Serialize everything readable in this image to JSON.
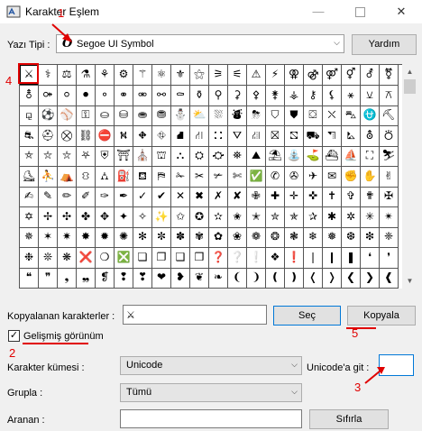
{
  "window": {
    "title": "Karakter Eşlem",
    "minimize_glyph": "—",
    "close_glyph": "✕"
  },
  "font_row": {
    "label": "Yazı Tipi :",
    "font_icon": "O",
    "selected_font": "Segoe UI Symbol",
    "help_label": "Yardım"
  },
  "chars": [
    [
      "⚔",
      "⚕",
      "⚖",
      "⚗",
      "⚘",
      "⚙",
      "⚚",
      "⚛",
      "⚜",
      "⚝",
      "⚞",
      "⚟",
      "⚠",
      "⚡",
      "⚢",
      "⚣",
      "⚤",
      "⚥",
      "⚦",
      "⚧"
    ],
    [
      "⚨",
      "⚩",
      "⚪",
      "⚫",
      "⚬",
      "⚭",
      "⚮",
      "⚯",
      "⚰",
      "⚱",
      "⚲",
      "⚳",
      "⚴",
      "⚵",
      "⚶",
      "⚷",
      "⚸",
      "⚹",
      "⚺",
      "⚻"
    ],
    [
      "⚼",
      "⚽",
      "⚾",
      "⚿",
      "⛀",
      "⛁",
      "⛂",
      "⛃",
      "⛄",
      "⛅",
      "⛆",
      "⛇",
      "⛈",
      "⛉",
      "⛊",
      "⛋",
      "⛌",
      "⛍",
      "⛎",
      "⛏"
    ],
    [
      "⛐",
      "⛑",
      "⛒",
      "⛓",
      "⛔",
      "⛕",
      "⛖",
      "⛗",
      "⛘",
      "⛙",
      "⛚",
      "⛛",
      "⛜",
      "⛝",
      "⛞",
      "⛟",
      "⛠",
      "⛡",
      "⛢",
      "⛣"
    ],
    [
      "⛤",
      "⛥",
      "⛦",
      "⛧",
      "⛨",
      "⛩",
      "⛪",
      "⛫",
      "⛬",
      "⛭",
      "⛮",
      "⛯",
      "⛰",
      "⛱",
      "⛲",
      "⛳",
      "⛴",
      "⛵",
      "⛶",
      "⛷"
    ],
    [
      "⛸",
      "⛹",
      "⛺",
      "⛻",
      "⛼",
      "⛽",
      "⛾",
      "⛿",
      "✁",
      "✂",
      "✃",
      "✄",
      "✅",
      "✆",
      "✇",
      "✈",
      "✉",
      "✊",
      "✋",
      "✌"
    ],
    [
      "✍",
      "✎",
      "✏",
      "✐",
      "✑",
      "✒",
      "✓",
      "✔",
      "✕",
      "✖",
      "✗",
      "✘",
      "✙",
      "✚",
      "✛",
      "✜",
      "✝",
      "✞",
      "✟",
      "✠"
    ],
    [
      "✡",
      "✢",
      "✣",
      "✤",
      "✥",
      "✦",
      "✧",
      "✨",
      "✩",
      "✪",
      "✫",
      "✬",
      "✭",
      "✮",
      "✯",
      "✰",
      "✱",
      "✲",
      "✳",
      "✴"
    ],
    [
      "✵",
      "✶",
      "✷",
      "✸",
      "✹",
      "✺",
      "✻",
      "✼",
      "✽",
      "✾",
      "✿",
      "❀",
      "❁",
      "❂",
      "❃",
      "❄",
      "❅",
      "❆",
      "❇",
      "❈"
    ],
    [
      "❉",
      "❊",
      "❋",
      "❌",
      "❍",
      "❎",
      "❏",
      "❐",
      "❑",
      "❒",
      "❓",
      "❔",
      "❕",
      "❖",
      "❗",
      "❘",
      "❙",
      "❚",
      "❛",
      "❜"
    ],
    [
      "❝",
      "❞",
      "❟",
      "❠",
      "❡",
      "❢",
      "❣",
      "❤",
      "❥",
      "❦",
      "❧",
      "❨",
      "❩",
      "❪",
      "❫",
      "❬",
      "❭",
      "❮",
      "❯",
      "❰"
    ]
  ],
  "copy_row": {
    "label": "Kopyalanan karakterler :",
    "value": "⚔",
    "select_label": "Seç",
    "copy_label": "Kopyala"
  },
  "advanced": {
    "label": "Gelişmiş görünüm",
    "checked_glyph": "✓"
  },
  "charset_row": {
    "label": "Karakter kümesi :",
    "value": "Unicode"
  },
  "unicode_goto": {
    "label": "Unicode'a git :",
    "value": ""
  },
  "group_row": {
    "label": "Grupla :",
    "value": "Tümü"
  },
  "search_row": {
    "label": "Aranan :",
    "value": "",
    "search_label": "Sıfırla"
  },
  "scroll": {
    "up_glyph": "▲",
    "down_glyph": "▼"
  },
  "annotations": {
    "n1": "1",
    "n2": "2",
    "n3": "3",
    "n4": "4",
    "n5": "5"
  },
  "colors": {
    "annotation": "#e00000",
    "accent": "#0078d7"
  }
}
